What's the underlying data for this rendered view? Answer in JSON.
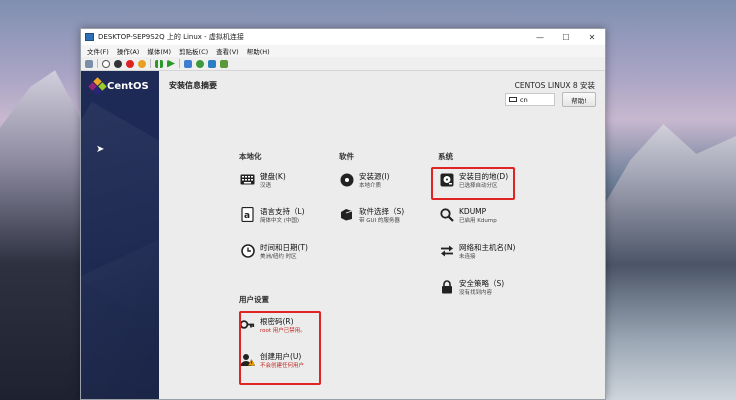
{
  "window": {
    "title": "DESKTOP-SEP9S2Q 上的 Linux - 虚拟机连接",
    "controls": [
      "—",
      "☐",
      "✕"
    ]
  },
  "menu": [
    "文件(F)",
    "操作(A)",
    "媒体(M)",
    "剪贴板(C)",
    "查看(V)",
    "帮助(H)"
  ],
  "installer": {
    "page_title": "安装信息摘要",
    "product": "CENTOS LINUX 8 安装",
    "keyboard_layout": "cn",
    "help_label": "帮助!",
    "logo_text": "CentOS"
  },
  "sections": {
    "localization": "本地化",
    "software": "软件",
    "system": "系统",
    "user_settings": "用户设置"
  },
  "spokes": {
    "keyboard": {
      "title": "键盘(K)",
      "status": "汉语"
    },
    "language": {
      "title": "语言支持（L)",
      "status": "简体中文 (中国)"
    },
    "datetime": {
      "title": "时间和日期(T)",
      "status": "美洲/纽约 时区"
    },
    "source": {
      "title": "安装源(I)",
      "status": "本地介质"
    },
    "software_selection": {
      "title": "软件选择（S)",
      "status": "带 GUI 的服务器"
    },
    "destination": {
      "title": "安装目的地(D)",
      "status": "已选择自动分区"
    },
    "kdump": {
      "title": "KDUMP",
      "status": "已启用 Kdump"
    },
    "network": {
      "title": "网络和主机名(N)",
      "status": "未连接"
    },
    "security": {
      "title": "安全策略（S)",
      "status": "没有找到内容"
    },
    "root": {
      "title": "根密码(R)",
      "status": "root 用户已禁用。"
    },
    "user": {
      "title": "创建用户(U)",
      "status": "不会创建任何用户"
    }
  },
  "colors": {
    "highlight": "#e02424",
    "warning_text": "#c0261f",
    "sidebar": "#1f2b57"
  }
}
